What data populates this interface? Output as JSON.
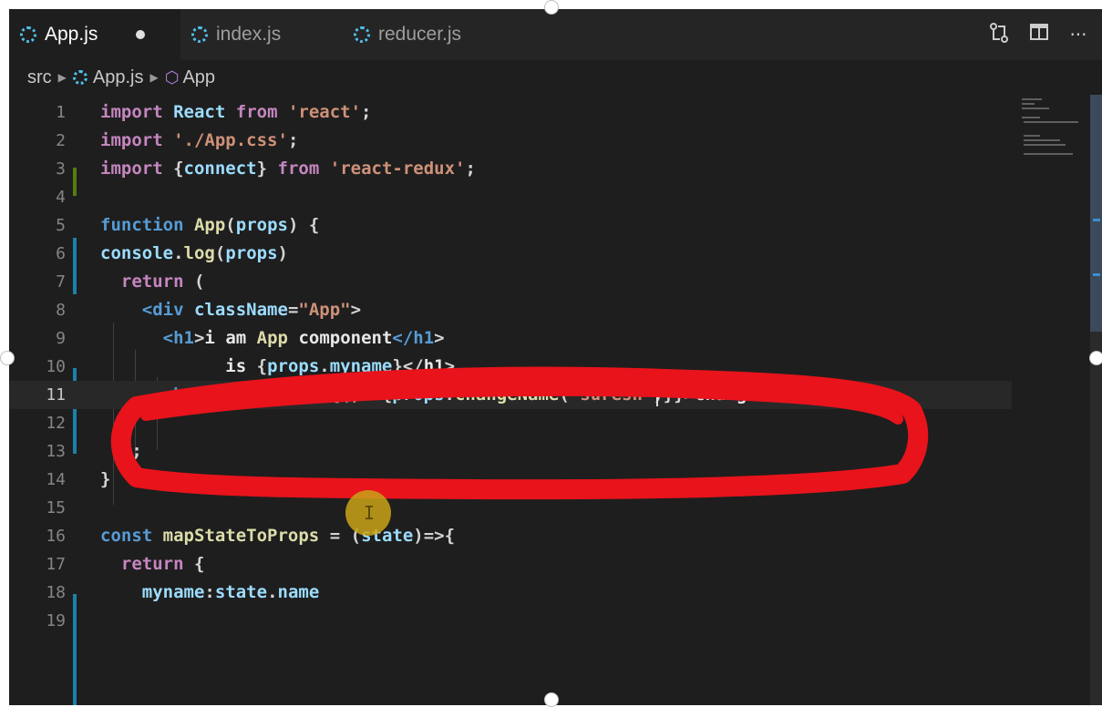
{
  "tabs": [
    {
      "label": "App.js",
      "active": true,
      "dirty": true
    },
    {
      "label": "index.js",
      "active": false
    },
    {
      "label": "reducer.js",
      "active": false
    }
  ],
  "toolbar": {
    "actions": [
      "source-control-compare-icon",
      "split-editor-icon",
      "more-actions-icon"
    ],
    "more_glyph": "···"
  },
  "breadcrumb": {
    "folder": "src",
    "file": "App.js",
    "symbol": "App"
  },
  "editor": {
    "current_line": 11,
    "lines": [
      {
        "n": "1",
        "text": "import React from 'react';"
      },
      {
        "n": "2",
        "text": "import './App.css';"
      },
      {
        "n": "3",
        "text": "import {connect} from 'react-redux';"
      },
      {
        "n": "4",
        "text": ""
      },
      {
        "n": "5",
        "text": "function App(props) {"
      },
      {
        "n": "6",
        "text": "console.log(props)"
      },
      {
        "n": "7",
        "text": "  return ("
      },
      {
        "n": "8",
        "text": "    <div className=\"App\">"
      },
      {
        "n": "9",
        "text": "      <h1>i am App component</h1>"
      },
      {
        "n": "10",
        "text": "            is {props.myname}</h1>"
      },
      {
        "n": "11",
        "text": "      <button onClick={()=>{props.changeName(\"suresh\")}}>change it</button>"
      },
      {
        "n": "12",
        "text": ""
      },
      {
        "n": "13",
        "text": "  );"
      },
      {
        "n": "14",
        "text": "}"
      },
      {
        "n": "15",
        "text": ""
      },
      {
        "n": "16",
        "text": "const mapStateToProps = (state)=>{"
      },
      {
        "n": "17",
        "text": "  return {"
      },
      {
        "n": "18",
        "text": "    myname:state.name"
      },
      {
        "n": "19",
        "text": ""
      }
    ]
  },
  "overlay": {
    "highlight_color": "#e8131b",
    "cursor_marker_color": "#c9a317",
    "cursor_glyph": "I"
  }
}
